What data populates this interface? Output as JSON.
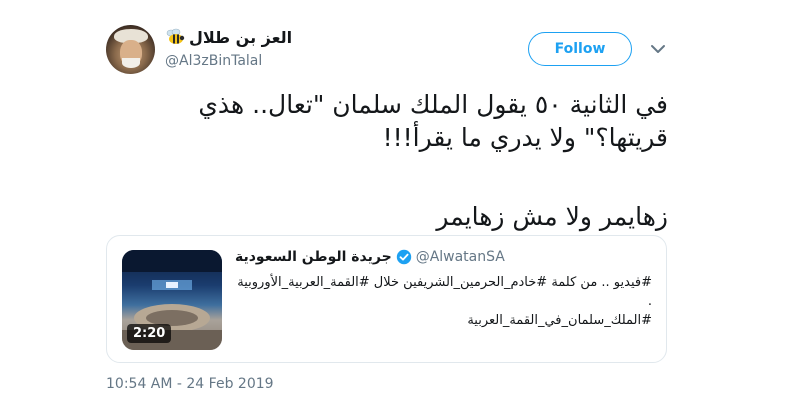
{
  "author": {
    "display_name": "العز بن طلال",
    "handle": "@Al3zBinTalal",
    "emoji_icon": "bee-icon"
  },
  "follow_button_label": "Follow",
  "menu_icon": "chevron-down-icon",
  "tweet": {
    "lines": [
      "في الثانية ٥٠ يقول الملك سلمان \"تعال.. هذي",
      "قريتها؟\" ولا يدري ما يقرأ!!!",
      "زهايمر ولا مش زهايمر"
    ]
  },
  "quoted_tweet": {
    "display_name": "جريدة الوطن السعودية",
    "verified": true,
    "handle": "@AlwatanSA",
    "text_lines": [
      "#فيديو .. من كلمة #خادم_الحرمين_الشريفين خلال #القمة_العربية_الأوروبية",
      ".",
      "#الملك_سلمان_في_القمة_العربية"
    ],
    "media": {
      "duration": "2:20"
    }
  },
  "timestamp": "10:54 AM - 24 Feb 2019",
  "colors": {
    "accent": "#1da1f2",
    "text": "#14171a",
    "secondary": "#657786",
    "border": "#e1e8ed"
  }
}
